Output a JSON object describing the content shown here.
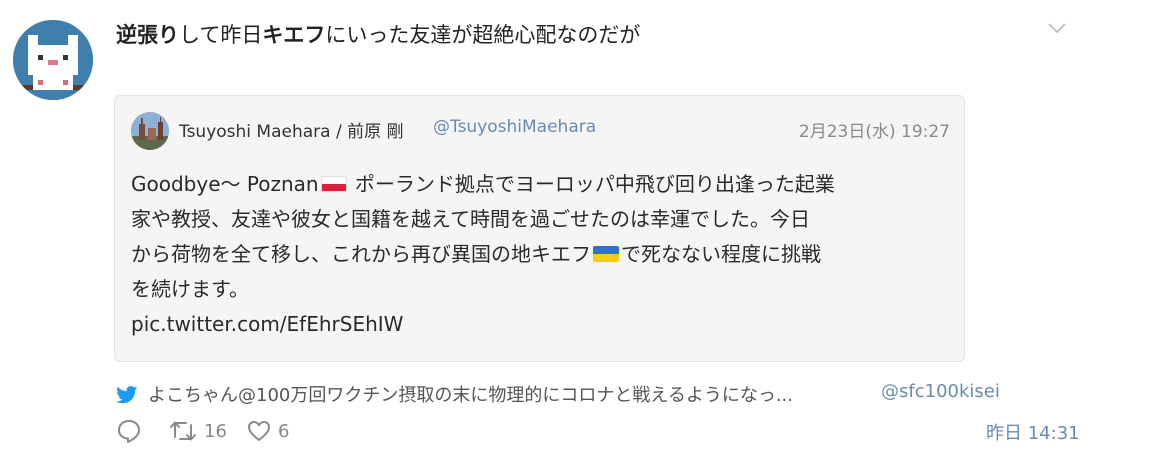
{
  "tweet": {
    "text_parts": [
      {
        "text": "逆張り",
        "bold": true
      },
      {
        "text": "して昨日",
        "bold": false
      },
      {
        "text": "キエフ",
        "bold": true
      },
      {
        "text": "にいった友達が超絶心配なのだが",
        "bold": false
      }
    ],
    "avatar_icon": "pixel-cat-avatar",
    "menu_icon": "chevron-down-icon"
  },
  "quote": {
    "name": "Tsuyoshi Maehara / 前原 剛",
    "handle": "@TsuyoshiMaehara",
    "date": "2月23日(水) 19:27",
    "lines": [
      {
        "before": "Goodbye〜 Poznan",
        "flag": "poland",
        "after": " ポーランド拠点でヨーロッパ中飛び回り出逢った起業"
      },
      {
        "before": "家や教授、友達や彼女と国籍を越えて時間を過ごせたのは幸運でした。今日",
        "flag": null,
        "after": ""
      },
      {
        "before": "から荷物を全て移し、これから再び異国の地キエフ",
        "flag": "ukraine",
        "after": "で死なない程度に挑戦"
      },
      {
        "before": "を続けます。",
        "flag": null,
        "after": ""
      }
    ],
    "link": "pic.twitter.com/EfEhrSEhIW"
  },
  "retweeted_by": {
    "text": "よこちゃん@100万回ワクチン摂取の末に物理的にコロナと戦えるようになっ...",
    "handle": "@sfc100kisei"
  },
  "actions": {
    "reply_count": "",
    "retweet_count": "16",
    "like_count": "6",
    "timestamp": "昨日 14:31"
  },
  "colors": {
    "link_blue": "#6a8bb0",
    "twitter_blue": "#1d9bf0",
    "quote_bg": "#f5f5f5"
  }
}
